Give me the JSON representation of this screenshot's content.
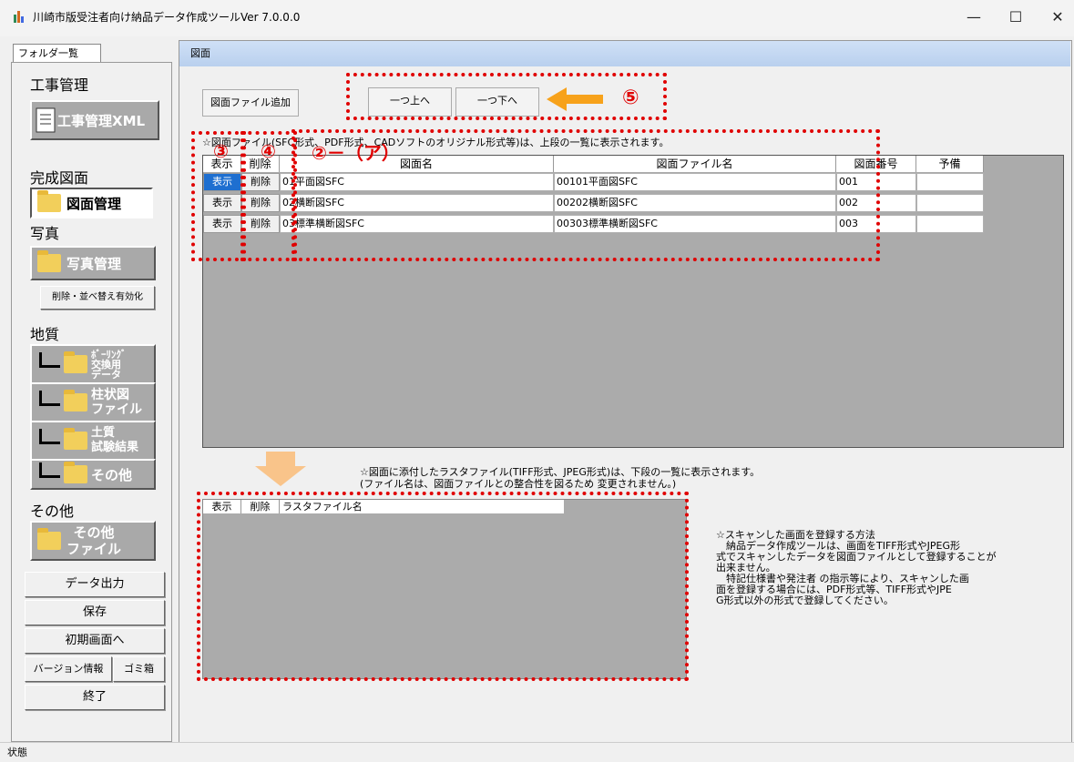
{
  "window": {
    "title": "川崎市版受注者向け納品データ作成ツールVer 7.0.0.0",
    "minimize": "—",
    "maximize": "☐",
    "close": "✕"
  },
  "sidebar": {
    "folder_tab": "フォルダ一覧",
    "sec_construction": "工事管理",
    "btn_construction_xml": "工事管理XML",
    "sec_drawings": "完成図面",
    "btn_drawings": "図面管理",
    "sec_photos": "写真",
    "btn_photos": "写真管理",
    "btn_delete_sort": "削除・並べ替え有効化",
    "sec_geology": "地質",
    "btn_boring": "ﾎﾞｰﾘﾝｸﾞ\n交換用\nデータ",
    "btn_column": "柱状図\nファイル",
    "btn_soil": "土質\n試験結果",
    "btn_geo_other": "その他",
    "sec_other": "その他",
    "btn_other_files": "その他\nファイル",
    "btn_export": "データ出力",
    "btn_save": "保存",
    "btn_home": "初期画面へ",
    "btn_version": "バージョン情報",
    "btn_trash": "ゴミ箱",
    "btn_exit": "終了"
  },
  "main": {
    "header": "図面",
    "btn_add_drawing": "図面ファイル追加",
    "btn_up": "一つ上へ",
    "btn_down": "一つ下へ",
    "note_top": "☆図面ファイル(SFC形式、PDF形式、CADソフトのオリジナル形式等)は、上段の一覧に表示されます。",
    "columns": [
      "表示",
      "削除",
      "図面名",
      "図面ファイル名",
      "図面番号",
      "予備"
    ],
    "rows": [
      {
        "show": "表示",
        "del": "削除",
        "name": "01平面図SFC",
        "file": "00101平面図SFC",
        "number": "001",
        "spare": ""
      },
      {
        "show": "表示",
        "del": "削除",
        "name": "02横断図SFC",
        "file": "00202横断図SFC",
        "number": "002",
        "spare": ""
      },
      {
        "show": "表示",
        "del": "削除",
        "name": "03標準横断図SFC",
        "file": "00303標準横断図SFC",
        "number": "003",
        "spare": ""
      }
    ],
    "note_raster_1": "☆図面に添付したラスタファイル(TIFF形式、JPEG形式)は、下段の一覧に表示されます。",
    "note_raster_2": "(ファイル名は、図面ファイルとの整合性を図るため 変更されません。)",
    "raster_columns": [
      "表示",
      "削除",
      "ラスタファイル名"
    ],
    "scan_note": "☆スキャンした画面を登録する方法\n　納品データ作成ツールは、画面をTIFF形式やJPEG形\n式でスキャンしたデータを図面ファイルとして登録することが\n出来ません。\n　特記仕様書や発注者 の指示等により、スキャンした画\n面を登録する場合には、PDF形式等、TIFF形式やJPE\nG形式以外の形式で登録してください。"
  },
  "annotations": {
    "a3": "③",
    "a4": "④",
    "a2": "②－（ア）",
    "a5": "⑤"
  },
  "status": "状態",
  "colors": {
    "annotation": "#e00000",
    "arrow_orange": "#f7a21b",
    "selected": "#1e6fd0"
  }
}
